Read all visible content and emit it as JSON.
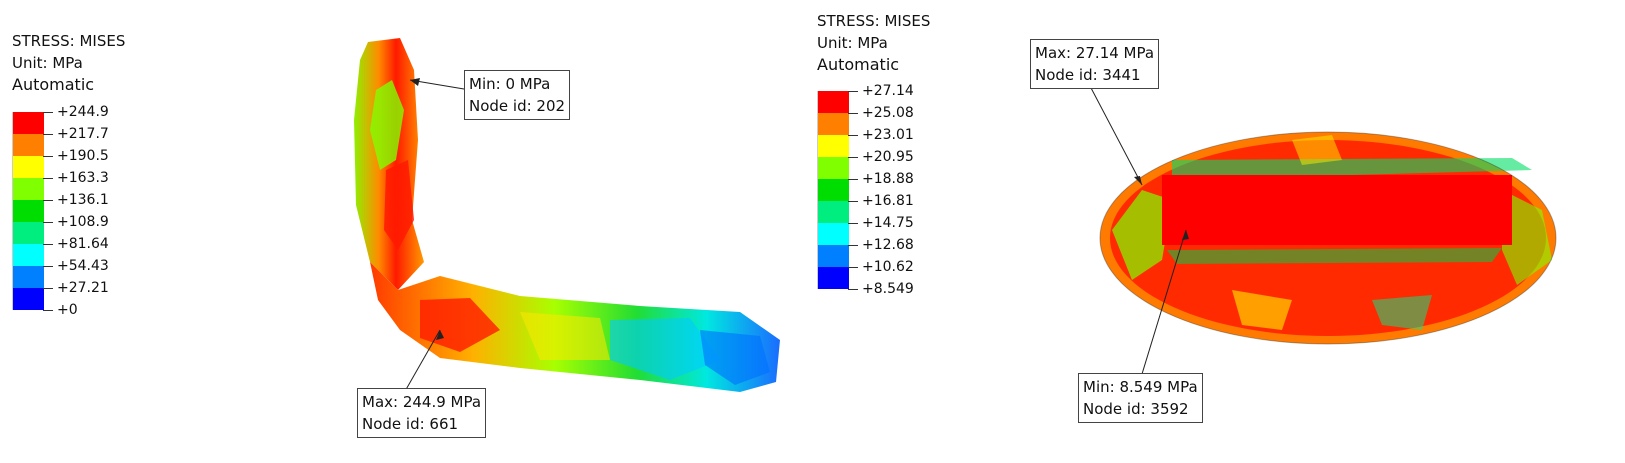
{
  "left": {
    "legend": {
      "title": "STRESS: MISES",
      "unit": "Unit: MPa",
      "mode": "Automatic",
      "ticks": [
        "+244.9",
        "+217.7",
        "+190.5",
        "+163.3",
        "+136.1",
        "+108.9",
        "+81.64",
        "+54.43",
        "+27.21",
        "+0"
      ],
      "colors": [
        "#ff0000",
        "#ff7f00",
        "#ffff00",
        "#7fff00",
        "#00dd00",
        "#00ee7f",
        "#00ffff",
        "#0080ff",
        "#0000ff"
      ]
    },
    "min_callout": {
      "label": "Min: 0 MPa",
      "node": "Node id: 202"
    },
    "max_callout": {
      "label": "Max: 244.9 MPa",
      "node": "Node id: 661"
    }
  },
  "right": {
    "legend": {
      "title": "STRESS: MISES",
      "unit": "Unit: MPa",
      "mode": "Automatic",
      "ticks": [
        "+27.14",
        "+25.08",
        "+23.01",
        "+20.95",
        "+18.88",
        "+16.81",
        "+14.75",
        "+12.68",
        "+10.62",
        "+8.549"
      ],
      "colors": [
        "#ff0000",
        "#ff7f00",
        "#ffff00",
        "#7fff00",
        "#00dd00",
        "#00ee7f",
        "#00ffff",
        "#0080ff",
        "#0000ff"
      ]
    },
    "max_callout": {
      "label": "Max: 27.14 MPa",
      "node": "Node id: 3441"
    },
    "min_callout": {
      "label": "Min: 8.549 MPa",
      "node": "Node id: 3592"
    }
  }
}
